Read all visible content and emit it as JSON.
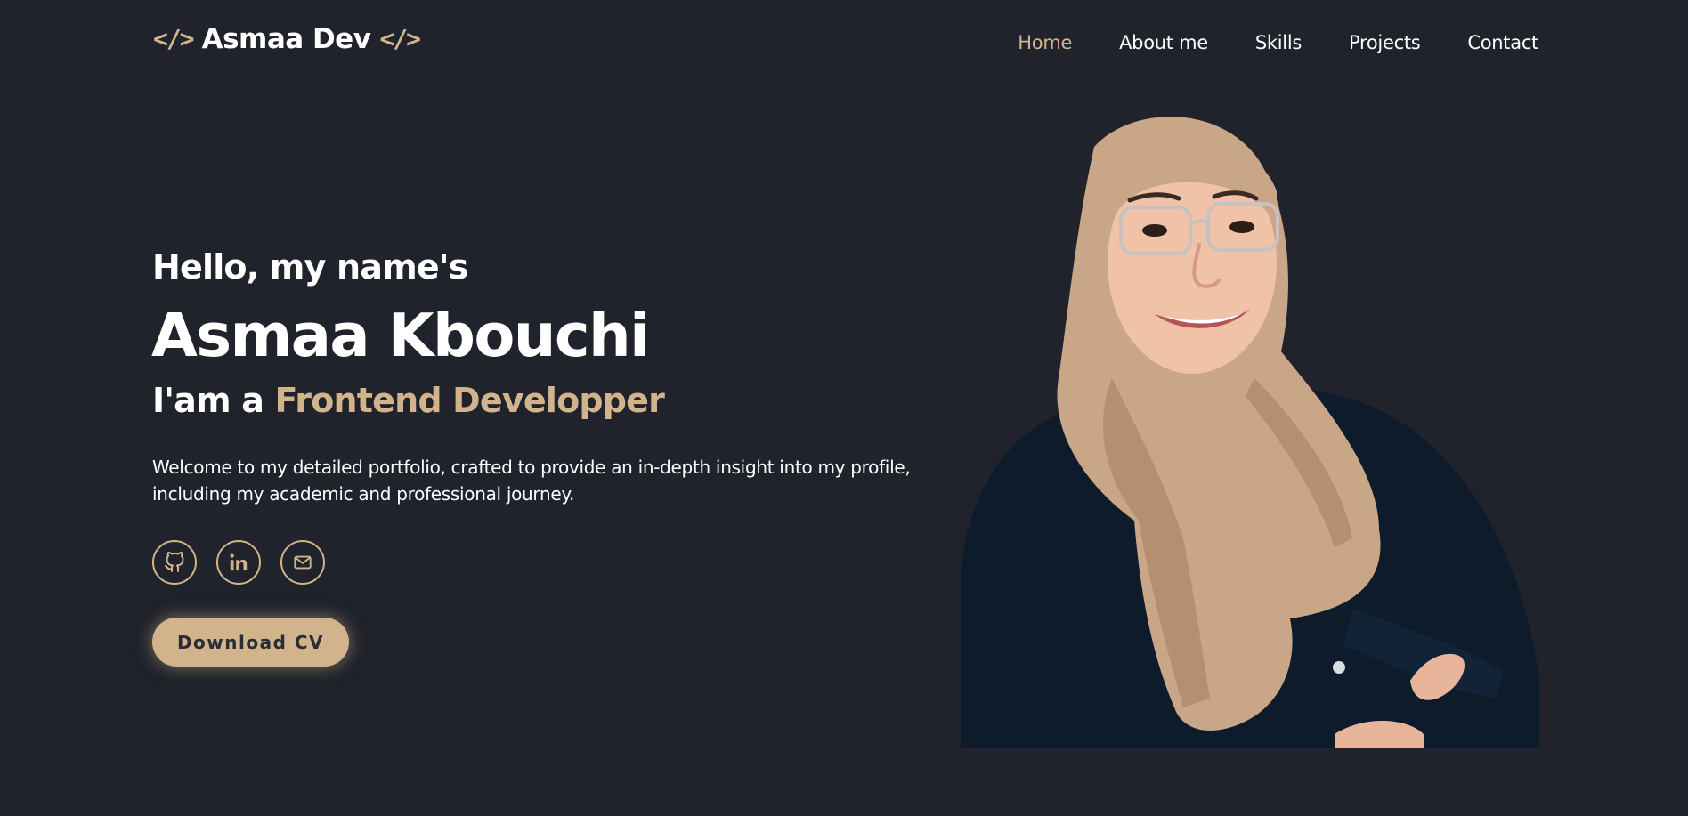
{
  "header": {
    "logo_icon_left": "</>",
    "logo_text": "Asmaa Dev",
    "logo_icon_right": "</>",
    "nav": [
      {
        "label": "Home",
        "active": true
      },
      {
        "label": "About me",
        "active": false
      },
      {
        "label": "Skills",
        "active": false
      },
      {
        "label": "Projects",
        "active": false
      },
      {
        "label": "Contact",
        "active": false
      }
    ]
  },
  "hero": {
    "greeting": "Hello, my name's",
    "name": "Asmaa Kbouchi",
    "role_prefix": "I'am a",
    "role_title": "Frontend Developper",
    "intro": "Welcome to my detailed portfolio, crafted to provide an in-depth insight into my profile, including my academic and professional journey.",
    "socials": [
      {
        "icon": "github-icon"
      },
      {
        "icon": "linkedin-icon"
      },
      {
        "icon": "mail-icon"
      }
    ],
    "cv_button": "Download CV"
  },
  "colors": {
    "background": "#20232b",
    "accent": "#d2b48c",
    "text": "#ffffff"
  }
}
